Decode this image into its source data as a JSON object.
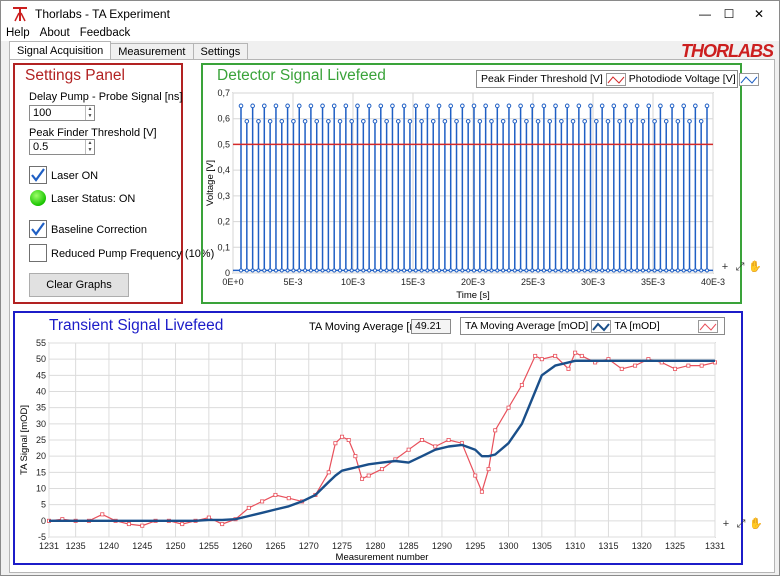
{
  "window": {
    "title": "Thorlabs - TA Experiment",
    "controls": {
      "minimize": "—",
      "maximize": "☐",
      "close": "✕"
    }
  },
  "menu": [
    "Help",
    "About",
    "Feedback"
  ],
  "tabs": [
    "Signal Acquisition",
    "Measurement",
    "Settings"
  ],
  "logo": "THORLABS",
  "settings_panel": {
    "title": "Settings Panel",
    "delay_label": "Delay Pump - Probe Signal [ns]",
    "delay_value": "100",
    "threshold_label": "Peak Finder Threshold [V]",
    "threshold_value": "0.5",
    "laser_on_label": "Laser ON",
    "laser_status_label": "Laser Status: ON",
    "baseline_label": "Baseline Correction",
    "reduced_label": "Reduced Pump Frequency (10%)",
    "clear_button": "Clear Graphs",
    "checkboxes": {
      "laser_on": true,
      "baseline": true,
      "reduced": false
    }
  },
  "detector_panel": {
    "title": "Detector Signal Livefeed",
    "legend_threshold": "Peak Finder Threshold [V]",
    "legend_voltage": "Photodiode Voltage [V]"
  },
  "transient_panel": {
    "title": "Transient Signal Livefeed",
    "readout_label": "TA Moving Average [mOD]",
    "readout_value": "49.21",
    "legend_avg": "TA Moving Average [mOD]",
    "legend_ta": "TA [mOD]"
  },
  "tools": [
    "+",
    "⤢",
    "✋"
  ],
  "colors": {
    "settings_border": "#b22222",
    "detector_border": "#3aa33a",
    "transient_border": "#1c1cc8",
    "threshold_line": "#d42b2b",
    "voltage_line": "#1f5fc4",
    "ta_line": "#e8505b",
    "avg_line": "#1a4f8a"
  },
  "chart_data": [
    {
      "type": "line",
      "title": "Detector Signal Livefeed",
      "xlabel": "Time [s]",
      "ylabel": "Voltage [V]",
      "xlim": [
        0,
        0.04
      ],
      "ylim": [
        0,
        0.7
      ],
      "x_ticks": [
        "0E+0",
        "5E-3",
        "10E-3",
        "15E-3",
        "20E-3",
        "25E-3",
        "30E-3",
        "35E-3",
        "40E-3"
      ],
      "y_ticks": [
        "0",
        "0,1",
        "0,2",
        "0,3",
        "0,4",
        "0,5",
        "0,6",
        "0,7"
      ],
      "grid": true,
      "legend": "top-right",
      "series": [
        {
          "name": "Peak Finder Threshold [V]",
          "kind": "constant",
          "value": 0.5
        },
        {
          "name": "Photodiode Voltage [V]",
          "kind": "pulses",
          "peak_count": 81,
          "peak_high": 0.65,
          "peak_low": 0.59,
          "baseline": 0.01
        }
      ]
    },
    {
      "type": "line",
      "title": "Transient Signal Livefeed",
      "xlabel": "Measurement number",
      "ylabel": "TA Signal [mOD]",
      "xlim": [
        1231,
        1331
      ],
      "ylim": [
        -5,
        55
      ],
      "x_ticks": [
        1231,
        1235,
        1240,
        1245,
        1250,
        1255,
        1260,
        1265,
        1270,
        1275,
        1280,
        1285,
        1290,
        1295,
        1300,
        1305,
        1310,
        1315,
        1320,
        1325,
        1331
      ],
      "y_ticks": [
        -5,
        0,
        5,
        10,
        15,
        20,
        25,
        30,
        35,
        40,
        45,
        50,
        55
      ],
      "grid": true,
      "legend": "top-right",
      "x": [
        1231,
        1233,
        1235,
        1237,
        1239,
        1241,
        1243,
        1245,
        1247,
        1249,
        1251,
        1253,
        1255,
        1257,
        1259,
        1261,
        1263,
        1265,
        1267,
        1269,
        1271,
        1273,
        1274,
        1275,
        1276,
        1277,
        1278,
        1279,
        1281,
        1283,
        1285,
        1287,
        1289,
        1291,
        1293,
        1295,
        1296,
        1297,
        1298,
        1300,
        1302,
        1304,
        1305,
        1307,
        1309,
        1310,
        1311,
        1313,
        1315,
        1317,
        1319,
        1321,
        1323,
        1325,
        1327,
        1329,
        1331
      ],
      "series": [
        {
          "name": "TA [mOD]",
          "values": [
            0,
            0.5,
            0,
            0,
            2,
            0,
            -1,
            -1.5,
            0,
            0,
            -1,
            0,
            1,
            -1,
            0.5,
            4,
            6,
            8,
            7,
            6,
            8,
            15,
            24,
            26,
            25,
            20,
            13,
            14,
            16,
            19,
            22,
            25,
            23,
            25,
            24,
            14,
            9,
            16,
            28,
            35,
            42,
            51,
            50,
            51,
            47,
            52,
            51,
            49,
            50,
            47,
            48,
            50,
            49,
            47,
            48,
            48,
            49
          ]
        },
        {
          "name": "TA Moving Average [mOD]",
          "values": [
            0,
            0,
            0,
            0,
            0,
            0,
            0,
            0,
            0,
            0,
            0,
            0,
            0.3,
            0.3,
            0.5,
            1.5,
            2.5,
            3.5,
            4.5,
            6,
            8,
            12,
            14,
            15.5,
            16,
            16.5,
            17,
            17.5,
            18,
            18.5,
            18,
            20,
            22,
            23,
            23.5,
            22,
            20,
            20,
            20.5,
            24,
            30,
            40,
            45,
            48,
            49,
            49.5,
            49.5,
            49.5,
            49.5,
            49.5,
            49.5,
            49.5,
            49.5,
            49.5,
            49.5,
            49.5,
            49.5
          ]
        }
      ]
    }
  ]
}
